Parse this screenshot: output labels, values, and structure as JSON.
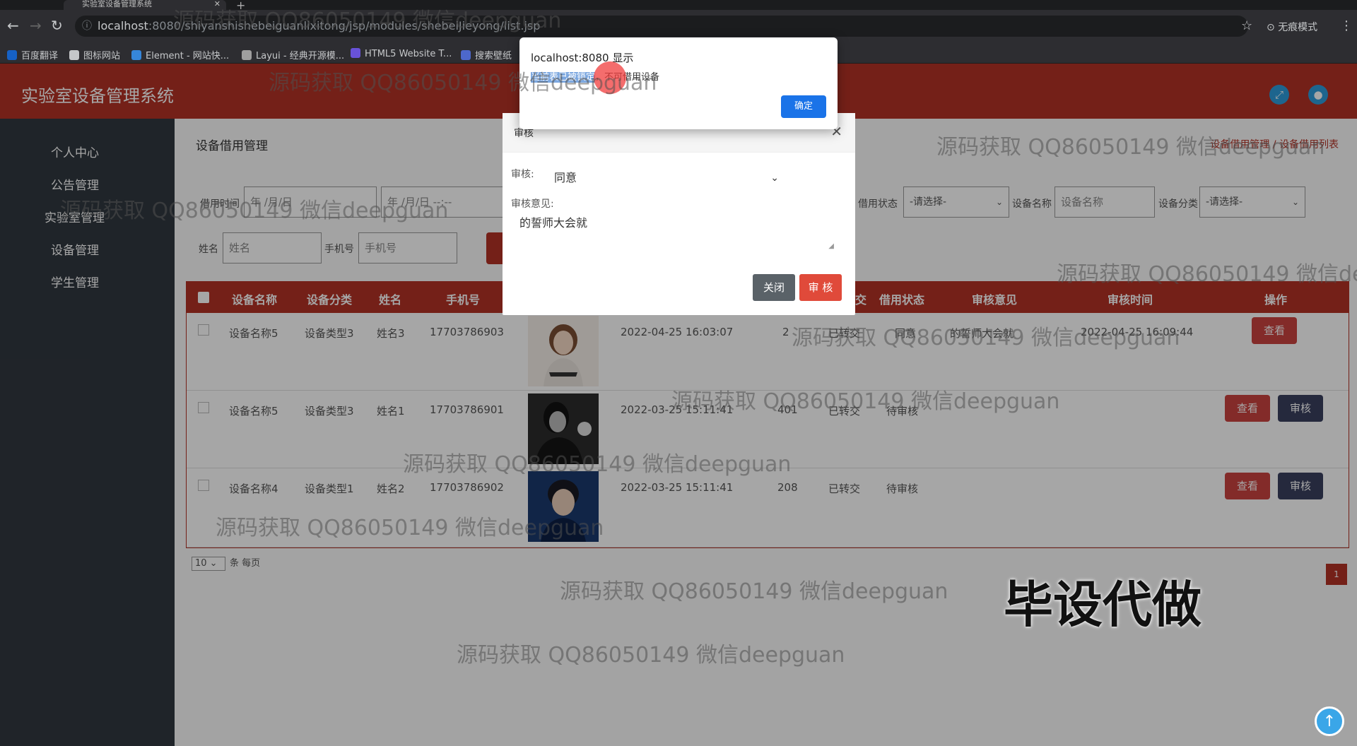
{
  "browser": {
    "tab_title": "实验室设备管理系统",
    "url_host": "localhost",
    "url_path": ":8080/shiyanshishebeiguanlixitong/jsp/modules/shebeiJieyong/list.jsp",
    "incognito_label": "无痕模式",
    "bookmarks": [
      "百度翻译",
      "图标网站",
      "Element - 网站快...",
      "Layui - 经典开源模...",
      "HTML5 Website T...",
      "搜索壁纸"
    ]
  },
  "app": {
    "title": "实验室设备管理系统"
  },
  "sidebar": {
    "items": [
      {
        "label": "个人中心"
      },
      {
        "label": "公告管理"
      },
      {
        "label": "实验室管理"
      },
      {
        "label": "设备管理"
      },
      {
        "label": "学生管理"
      }
    ]
  },
  "main": {
    "breadcrumb": "设备借用管理",
    "breadcrumb_right": "设备借用管理 / 设备借用列表"
  },
  "filters": {
    "date_label": "借用时间",
    "date_start_placeholder": "年 /月/日",
    "date_end_placeholder": "年 /月/日 --:--",
    "status_label": "借用状态",
    "status_value": "-请选择-",
    "name_label": "设备名称",
    "name_placeholder": "设备名称",
    "category_label": "设备分类",
    "category_value": "-请选择-",
    "person_label": "姓名",
    "person_placeholder": "姓名",
    "phone_label": "手机号",
    "phone_placeholder": "手机号"
  },
  "table": {
    "headers": [
      "设备名称",
      "设备分类",
      "姓名",
      "手机号",
      "交",
      "借用状态",
      "审核意见",
      "审核时间",
      "操作"
    ],
    "rows": [
      {
        "device": "设备名称5",
        "category": "设备类型3",
        "name": "姓名3",
        "phone": "17703786903",
        "time": "2022-04-25 16:03:07",
        "room": "2",
        "transfer": "已转交",
        "status": "同意",
        "opinion": "的誓师大会就",
        "audit_time": "2022-04-25 16:09:44",
        "actions": [
          "查看"
        ]
      },
      {
        "device": "设备名称5",
        "category": "设备类型3",
        "name": "姓名1",
        "phone": "17703786901",
        "time": "2022-03-25 15:11:41",
        "room": "401",
        "transfer": "已转交",
        "status": "待审核",
        "opinion": "",
        "audit_time": "",
        "actions": [
          "查看",
          "审核"
        ]
      },
      {
        "device": "设备名称4",
        "category": "设备类型1",
        "name": "姓名2",
        "phone": "17703786902",
        "time": "2022-03-25 15:11:41",
        "room": "208",
        "transfer": "已转交",
        "status": "待审核",
        "opinion": "",
        "audit_time": "",
        "actions": [
          "查看",
          "审核"
        ]
      }
    ]
  },
  "pager": {
    "page_size": "10",
    "suffix": "条 每页",
    "current_page": "1"
  },
  "modal": {
    "title": "审核",
    "audit_label": "审核:",
    "audit_value": "同意",
    "opinion_label": "审核意见:",
    "opinion_value": "的誓师大会就",
    "close_btn": "关闭",
    "ok_btn": "审 核"
  },
  "alert": {
    "title": "localhost:8080 显示",
    "message_hl": "当前表已被锁定",
    "message_rest": "，不可借用设备",
    "ok_btn": "确定"
  },
  "watermark": "源码获取 QQ86050149 微信deepguan",
  "stamp": "毕设代做"
}
